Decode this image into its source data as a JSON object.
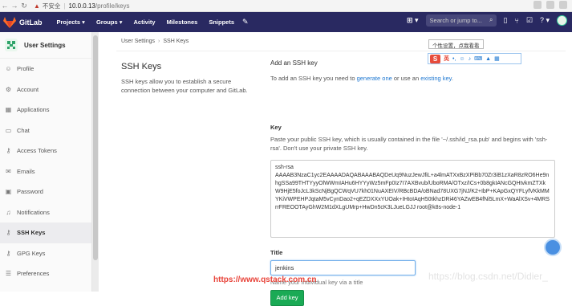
{
  "browser": {
    "warning_icon": "warning-triangle-icon",
    "insecure_label": "不安全",
    "url_host": "10.0.0.13",
    "url_path": "/profile/keys"
  },
  "header": {
    "brand": "GitLab",
    "nav": [
      "Projects ▾",
      "Groups ▾",
      "Activity",
      "Milestones",
      "Snippets"
    ],
    "search_placeholder": "Search or jump to..."
  },
  "sidebar": {
    "title": "User Settings",
    "items": [
      {
        "label": "Profile",
        "icon": "user-icon"
      },
      {
        "label": "Account",
        "icon": "account-gear-icon"
      },
      {
        "label": "Applications",
        "icon": "grid-icon"
      },
      {
        "label": "Chat",
        "icon": "chat-icon"
      },
      {
        "label": "Access Tokens",
        "icon": "key-icon"
      },
      {
        "label": "Emails",
        "icon": "envelope-icon"
      },
      {
        "label": "Password",
        "icon": "lock-icon"
      },
      {
        "label": "Notifications",
        "icon": "bell-icon"
      },
      {
        "label": "SSH Keys",
        "icon": "ssh-key-icon"
      },
      {
        "label": "GPG Keys",
        "icon": "gpg-key-icon"
      },
      {
        "label": "Preferences",
        "icon": "preferences-icon"
      }
    ]
  },
  "breadcrumb": {
    "parent": "User Settings",
    "current": "SSH Keys"
  },
  "main": {
    "heading": "SSH Keys",
    "description": "SSH keys allow you to establish a secure connection between your computer and GitLab.",
    "add_heading": "Add an SSH key",
    "add_text_prefix": "To add an SSH key you need to ",
    "generate_link": "generate one",
    "add_text_mid": " or use an ",
    "existing_link": "existing key",
    "add_text_suffix": ".",
    "key_label": "Key",
    "key_help": "Paste your public SSH key, which is usually contained in the file '~/.ssh/id_rsa.pub' and begins with 'ssh-rsa'. Don't use your private SSH key.",
    "key_value": "ssh-rsa\nAAAAB3NzaC1yc2EAAAADAQABAAABAQDeUq9NuzJewJfiL+a4lmATXxBzXPiBb70Zr3iB1zXaR8zRO6He9nhgSSa99THTYyyOlWWmIAHu6HYYyWz5mFp0Iz7I7AXBvub/UboRMA/OTxz/ICs+0b8gkIANcGQHtvkmZTXkW9HjE5foJcL3kScNjBgQCWqVU7kh01NuAXEIV/RBcBDA/oBNad78UXG7jNJ/K2+IbP+KApGxQYFLyfVKkMMYKiVWPEHPJqtaM5vCynDao2+qEZDXXxYUOak+IHtoIAqH50tkhzDRi46YAZwEB4fNi5LmX+WaAlXSv+4MRSrrFREOOTAyGhW2M1dXLgUMrp+HwDn5cK3LJueLGJJ root@k8s-node-1",
    "title_label": "Title",
    "title_value": "jenkins",
    "title_help": "Name your individual key via a title",
    "add_button": "Add key"
  },
  "ime": {
    "tooltip": "个性设置，点我看看",
    "logo": "S",
    "mode": "英"
  },
  "watermark": {
    "left": "https://www.qstack.com.cn",
    "right": "https://blog.csdn.net/Didier_"
  }
}
